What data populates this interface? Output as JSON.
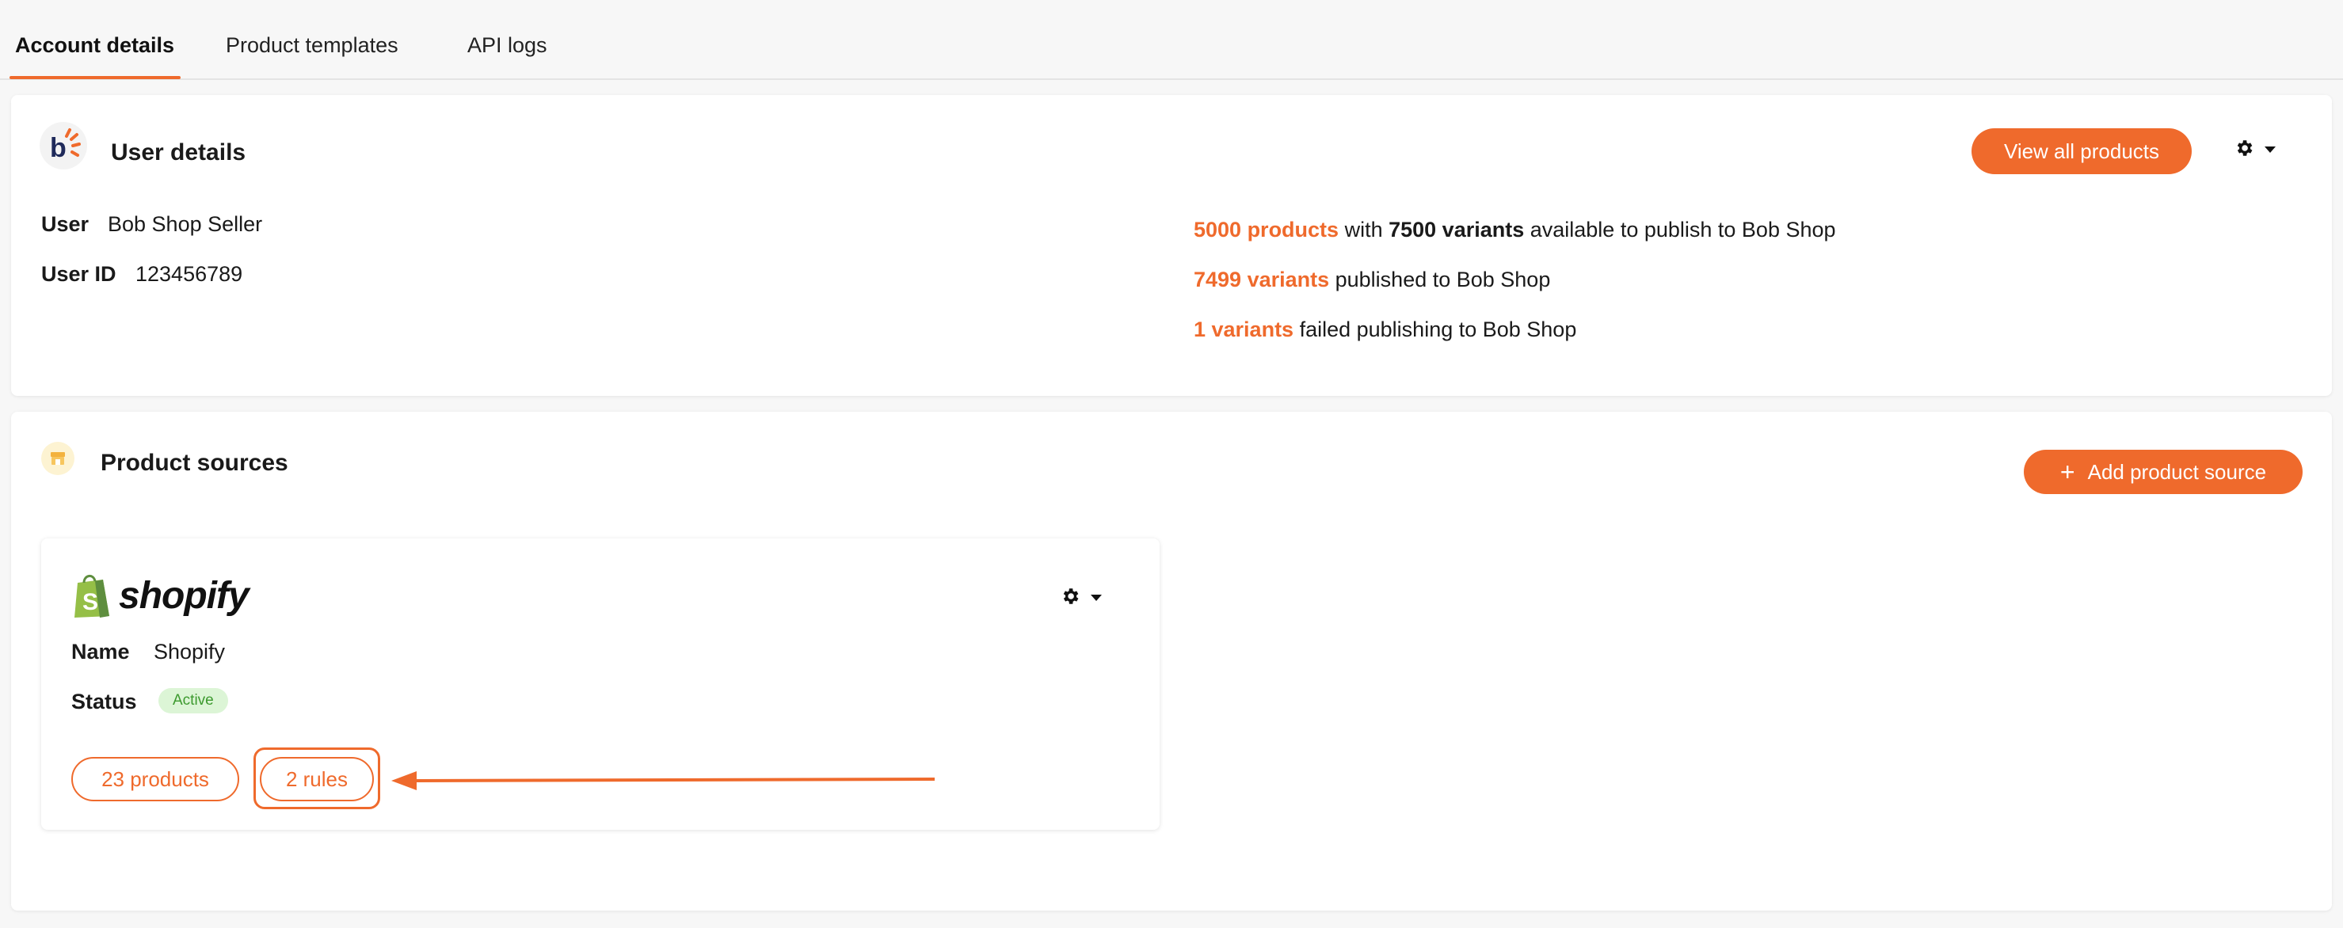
{
  "tabs": [
    {
      "label": "Account details",
      "active": true
    },
    {
      "label": "Product templates",
      "active": false
    },
    {
      "label": "API logs",
      "active": false
    }
  ],
  "user_details": {
    "title": "User details",
    "view_all_label": "View all products",
    "user_label": "User",
    "user_value": "Bob Shop Seller",
    "user_id_label": "User ID",
    "user_id_value": "123456789",
    "stats": {
      "line1_products": "5000 products",
      "line1_with": " with ",
      "line1_variants": "7500 variants",
      "line1_rest": " available to publish to Bob Shop",
      "line2_variants": "7499 variants",
      "line2_rest": " published to Bob Shop",
      "line3_variants": "1 variants",
      "line3_rest": " failed publishing to Bob Shop"
    }
  },
  "product_sources": {
    "title": "Product sources",
    "add_label": "Add product source",
    "add_icon": "plus-icon",
    "source": {
      "logo_text": "shopify",
      "name_label": "Name",
      "name_value": "Shopify",
      "status_label": "Status",
      "status_value": "Active",
      "products_label": "23 products",
      "rules_label": "2 rules"
    }
  },
  "colors": {
    "accent": "#ef6a2c",
    "active_badge_bg": "#dcf5d6",
    "active_badge_text": "#3c9a2e",
    "shopify_green": "#95bf47"
  }
}
